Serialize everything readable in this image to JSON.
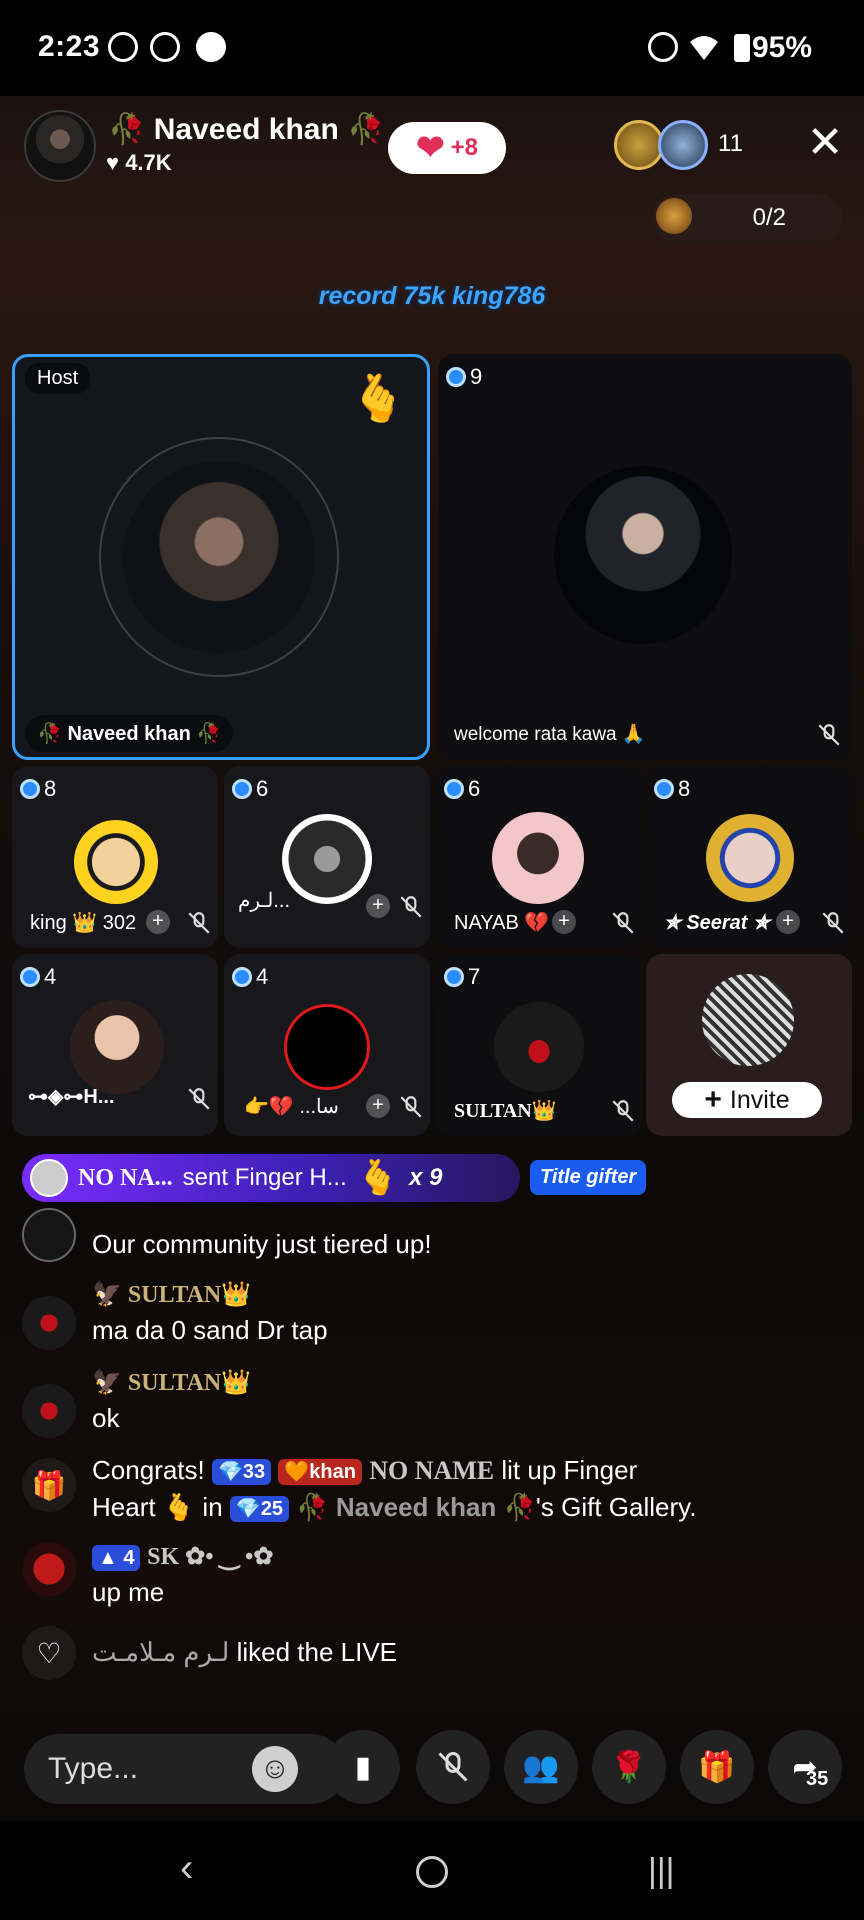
{
  "status_bar": {
    "time": "2:23",
    "battery": "95%"
  },
  "header": {
    "host_name": "Naveed khan",
    "host_likes": "4.7K",
    "like_delta": "+8",
    "viewer_count": "11",
    "seat_count": "0/2"
  },
  "banner": "record 75k king786",
  "host_seat": {
    "tag": "Host",
    "name": "Naveed khan"
  },
  "seats": [
    {
      "num": "9",
      "name": "welcome rata kawa 🙏"
    },
    {
      "num": "8",
      "name": "king 👑 302"
    },
    {
      "num": "6",
      "name": "ﻟـﺮﻡ..."
    },
    {
      "num": "6",
      "name": "NAYAB 💔"
    },
    {
      "num": "8",
      "name": "✯ Seerat ✯"
    },
    {
      "num": "4",
      "name": "⊶◈⊶H..."
    },
    {
      "num": "4",
      "name": "👉💔 ...سا"
    },
    {
      "num": "7",
      "name": "SULTAN👑"
    }
  ],
  "invite_label": "Invite",
  "gift_bar": {
    "sender": "NO NA...",
    "text": "sent Finger H...",
    "multiplier": "x 9",
    "title_tag": "Title gifter"
  },
  "chat": [
    {
      "text": "Our community just tiered up!"
    },
    {
      "name": "SULTAN👑",
      "text": "ma da 0 sand  Dr tap"
    },
    {
      "name": "SULTAN👑",
      "text": "ok"
    },
    {
      "congrats": "Congrats!",
      "badge1": "33",
      "badge2": "khan",
      "gifter": "NO NAME",
      "mid": "lit up Finger",
      "line2a": "Heart",
      "line2b": "in",
      "badge3": "25",
      "host": "Naveed khan",
      "tail": "'s Gift Gallery."
    },
    {
      "badge": "4",
      "name": "SK ✿• ‿ •✿",
      "text": "up me"
    },
    {
      "liker": "ﻟـﺮﻡ ﻣـﻼﻣـﺖ",
      "text": "liked the LIVE"
    }
  ],
  "input": {
    "placeholder": "Type..."
  },
  "share_count": "35",
  "colors": {
    "accent_blue": "#3aa0ff",
    "gift_purple": "#7a2cff",
    "banner_blue": "#3aa6ff",
    "like_red": "#e0305a"
  },
  "icons": [
    "camera-icon",
    "whatsapp-icon",
    "facebook-icon",
    "dnd-icon",
    "wifi-icon",
    "battery-icon",
    "heart-icon",
    "close-icon",
    "mic-off-icon",
    "video-off-icon",
    "people-icon",
    "rose-icon",
    "gift-icon",
    "share-icon",
    "emoji-icon",
    "back-icon",
    "home-icon",
    "recents-icon"
  ]
}
